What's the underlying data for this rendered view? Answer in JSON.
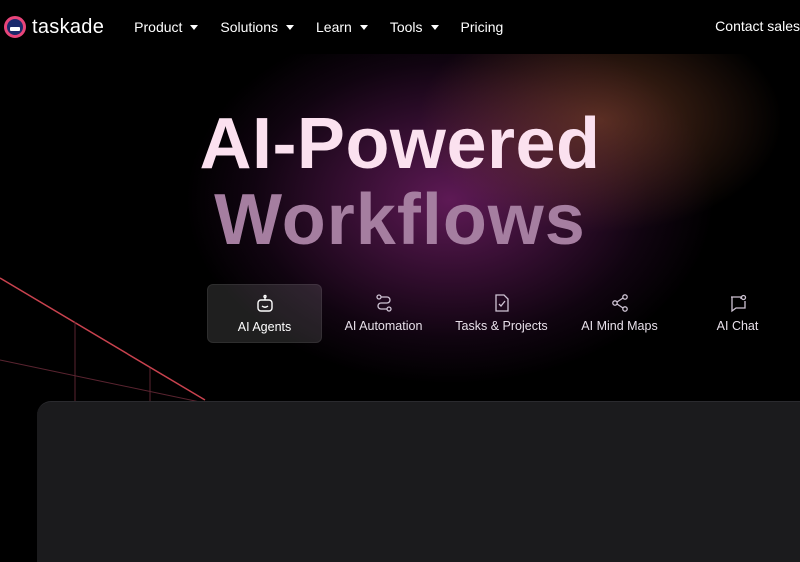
{
  "brand": {
    "name": "taskade"
  },
  "nav": {
    "items": [
      {
        "label": "Product",
        "has_dropdown": true
      },
      {
        "label": "Solutions",
        "has_dropdown": true
      },
      {
        "label": "Learn",
        "has_dropdown": true
      },
      {
        "label": "Tools",
        "has_dropdown": true
      },
      {
        "label": "Pricing",
        "has_dropdown": false
      }
    ],
    "contact_label": "Contact sales"
  },
  "hero": {
    "line1": "AI-Powered",
    "line2": "Workflows"
  },
  "tabs": [
    {
      "label": "AI Agents",
      "icon": "robot-icon",
      "active": true
    },
    {
      "label": "AI Automation",
      "icon": "automation-icon",
      "active": false
    },
    {
      "label": "Tasks & Projects",
      "icon": "task-edit-icon",
      "active": false
    },
    {
      "label": "AI Mind Maps",
      "icon": "share-nodes-icon",
      "active": false
    },
    {
      "label": "AI Chat",
      "icon": "chat-icon",
      "active": false
    }
  ],
  "colors": {
    "background": "#000000",
    "headline_primary": "#fbe1ef",
    "headline_secondary": "#a57ea0",
    "glow_purple": "#6e1e64",
    "glow_orange": "#965032",
    "panel": "#1b1b1d",
    "rail": "#c8424e"
  }
}
